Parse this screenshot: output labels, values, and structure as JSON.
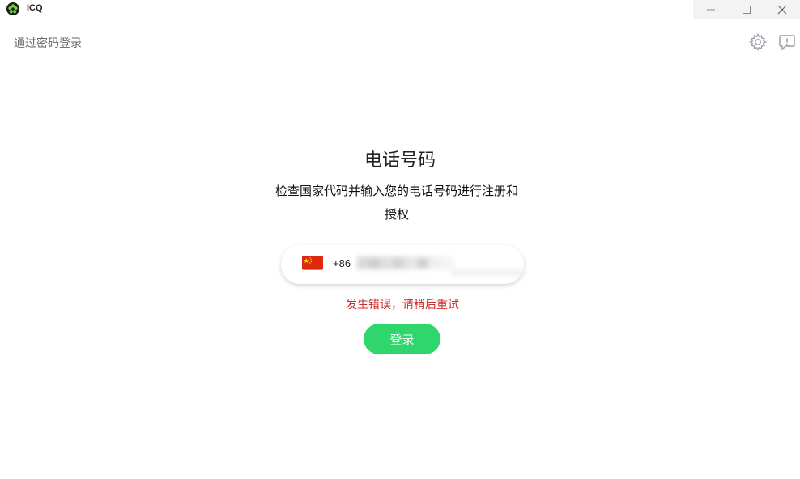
{
  "window": {
    "title": "ICQ",
    "controls": [
      "minimize-icon",
      "maximize-icon",
      "close-icon"
    ]
  },
  "topbar": {
    "password_login_link": "通过密码登录",
    "icons": [
      "gear-icon",
      "feedback-icon"
    ]
  },
  "main": {
    "title": "电话号码",
    "subtitle": "检查国家代码并输入您的电话号码进行注册和授权",
    "phone": {
      "country_flag": "china-flag-icon",
      "country_code": "+86",
      "value": "",
      "placeholder": ""
    },
    "error_message": "发生错误，请稍后重试",
    "login_button": "登录"
  },
  "colors": {
    "accent": "#2fd66b",
    "error": "#d12c2c",
    "flag_red": "#de2910",
    "flag_yellow": "#ffde00"
  }
}
